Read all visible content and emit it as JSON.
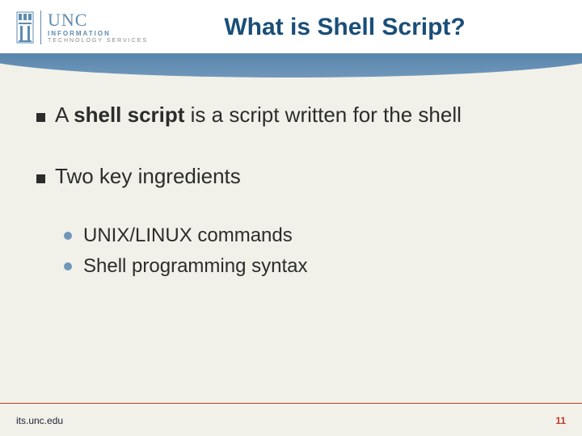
{
  "header": {
    "logo": {
      "main": "UNC",
      "sub1": "INFORMATION",
      "sub2": "TECHNOLOGY SERVICES"
    },
    "title": "What is Shell Script?"
  },
  "content": {
    "point1_pre": "A ",
    "point1_bold": "shell script",
    "point1_post": " is a script written for the shell",
    "point2": "Two key ingredients",
    "sub": [
      "UNIX/LINUX commands",
      "Shell programming syntax"
    ]
  },
  "footer": {
    "url": "its.unc.edu",
    "page": "11"
  }
}
